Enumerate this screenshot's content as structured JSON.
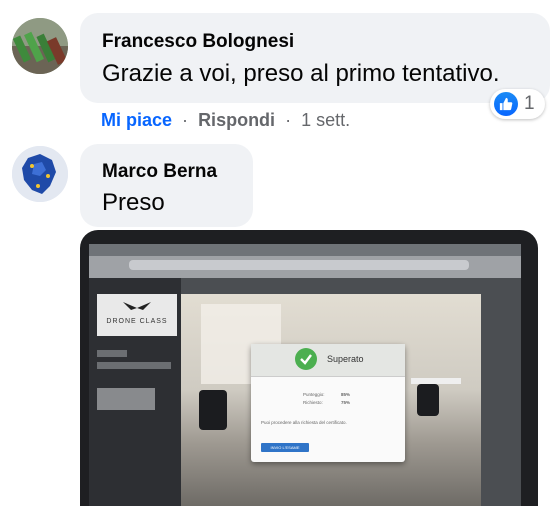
{
  "comments": [
    {
      "author": "Francesco Bolognesi",
      "text": "Grazie a voi, preso al primo tentativo.",
      "reaction": {
        "icon": "thumbs-up-icon",
        "count": "1",
        "color": "#0866ff"
      },
      "actions": {
        "like": "Mi piace",
        "separator": "·",
        "reply": "Rispondi",
        "time": "1 sett."
      }
    },
    {
      "author": "Marco Berna",
      "text": "Preso",
      "attachment": {
        "type": "photo",
        "content": {
          "logo": "DRONE CLASS",
          "dialog_title": "Superato",
          "score_label": "Punteggio:",
          "score_value": "85%",
          "required_label": "Richiesto:",
          "required_value": "75%",
          "note": "Puoi procedere alla richiesta del certificato.",
          "button": "INVIO L'ESAME"
        }
      }
    }
  ],
  "colors": {
    "bubble": "#f0f2f5",
    "link": "#0866ff",
    "meta": "#65676b",
    "success": "#4caf50"
  }
}
